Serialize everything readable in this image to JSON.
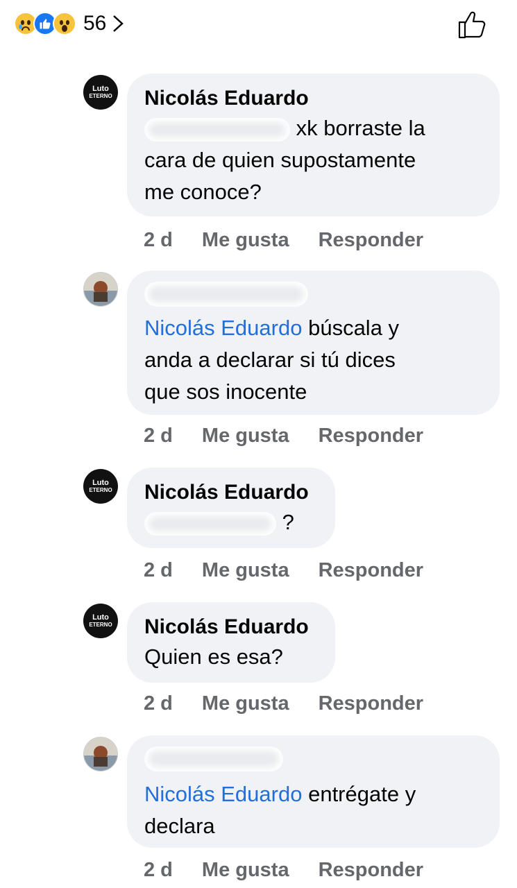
{
  "header": {
    "reaction_count": "56",
    "reactions": [
      "sad-reaction",
      "like-reaction",
      "wow-reaction"
    ]
  },
  "comments": [
    {
      "avatar_line1": "Luto",
      "avatar_line2": "ETERNO",
      "author": "Nicolás Eduardo",
      "text_after_redaction": "xk borraste la",
      "text_lines": [
        "cara de quien supostamente",
        "me conoce?"
      ],
      "time": "2 d",
      "like_label": "Me gusta",
      "reply_label": "Responder"
    },
    {
      "mention": "Nicolás Eduardo",
      "text_after_mention": " búscala y",
      "text_lines": [
        "anda a declarar si tú dices",
        "que sos inocente"
      ],
      "time": "2 d",
      "like_label": "Me gusta",
      "reply_label": "Responder"
    },
    {
      "avatar_line1": "Luto",
      "avatar_line2": "ETERNO",
      "author": "Nicolás Eduardo",
      "text_after_redaction": "?",
      "time": "2 d",
      "like_label": "Me gusta",
      "reply_label": "Responder"
    },
    {
      "avatar_line1": "Luto",
      "avatar_line2": "ETERNO",
      "author": "Nicolás Eduardo",
      "text": "Quien es esa?",
      "time": "2 d",
      "like_label": "Me gusta",
      "reply_label": "Responder"
    },
    {
      "mention": "Nicolás Eduardo",
      "text_after_mention": " entrégate y",
      "text_lines": [
        "declara"
      ],
      "time": "2 d",
      "like_label": "Me gusta",
      "reply_label": "Responder"
    }
  ],
  "colors": {
    "bubble": "#f0f2f5",
    "mention": "#216fdb",
    "meta": "#65676b",
    "like_reaction": "#1877f2"
  }
}
